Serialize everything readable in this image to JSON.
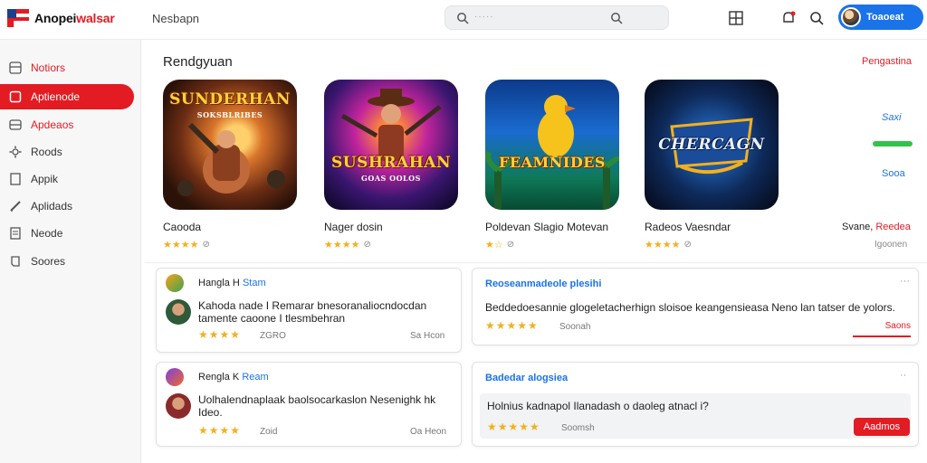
{
  "header": {
    "logo_a": "Anopei",
    "logo_b": "walsar",
    "nav_link": "Nesbapn",
    "search_placeholder": "·····",
    "profile_label": "Toaoeat"
  },
  "sidebar": {
    "items": [
      {
        "label": "Notiors",
        "icon": "grid-icon"
      },
      {
        "label": "Aptienode",
        "icon": "square-icon"
      },
      {
        "label": "Apdeaos",
        "icon": "stack-icon"
      },
      {
        "label": "Roods",
        "icon": "gear-icon"
      },
      {
        "label": "Appik",
        "icon": "doc-icon"
      },
      {
        "label": "Aplidads",
        "icon": "pencil-icon"
      },
      {
        "label": "Neode",
        "icon": "list-icon"
      },
      {
        "label": "Soores",
        "icon": "scroll-icon"
      }
    ]
  },
  "featured": {
    "title": "Rendgyuan",
    "link": "Pengastina",
    "cards": [
      {
        "name": "Caooda",
        "art_title": "SUNDERHAN",
        "art_sub": "SOKSBLRIBES",
        "stars": "★★★★",
        "rating_extra": "⊘"
      },
      {
        "name": "Nager dosin",
        "art_title": "SUSHRAHAN",
        "art_sub": "GOAS OOLOS",
        "stars": "★★★★",
        "rating_extra": "⊘"
      },
      {
        "name": "Poldevan Slagio Motevan",
        "art_title": "FEAMNIDES",
        "art_sub": "",
        "stars": "★☆",
        "rating_extra": "⊘"
      },
      {
        "name": "Radeos Vaesndar",
        "art_title": "CHERCAGN",
        "art_sub": "",
        "stars": "★★★★",
        "rating_extra": "⊘"
      }
    ],
    "side_top": "Saxi",
    "side_bottom": "Sooa",
    "side_name": "Svane,",
    "side_name_red": "Reedea",
    "side_meta": "Igoonen"
  },
  "reviews": [
    {
      "title_a": "Hangla",
      "title_b": "H",
      "title_c": "Stam",
      "text": "Kahoda nade I Remarar bnesoranaliocndocdan tamente caoone I tlesmbehran",
      "stars": "★★★★",
      "meta_left": "ZGRO",
      "meta_right": "Sa Hcon"
    },
    {
      "title_a": "Rengla",
      "title_b": "K",
      "title_c": "Ream",
      "text": "Uolhalendnaplaak baolsocarkaslon Nesenighk hk Ideo.",
      "stars": "★★★★",
      "meta_left": "Zoid",
      "meta_right": "Oa Heon"
    }
  ],
  "notes": [
    {
      "title": "Reoseanmadeole plesihi",
      "text": "Beddedoesannie glogeletacherhign sloisoe keangensieasa Neno lan tatser de yolors.",
      "stars": "★★★★★",
      "meta": "Soonah",
      "button": "Saons"
    },
    {
      "title": "Badedar alogsiea",
      "text": "Holnius kadnapol Ilanadash o daoleg atnacl i?",
      "stars": "★★★★★",
      "meta": "Soomsh",
      "button": "Aadmos"
    }
  ],
  "colors": {
    "brand_red": "#e31b23",
    "accent_blue": "#1a73e8",
    "star": "#f2b01e",
    "sidebar_bg": "#f7f7f8"
  }
}
